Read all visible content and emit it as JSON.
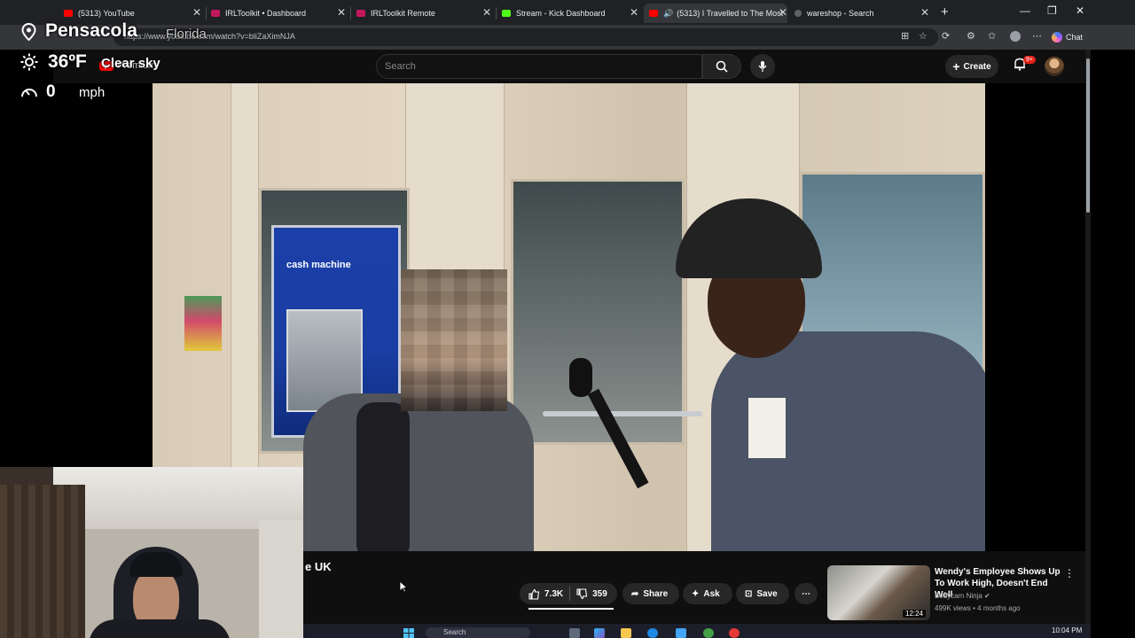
{
  "browser": {
    "tabs": [
      {
        "label": "(5313) YouTube",
        "color": "#ff0000"
      },
      {
        "label": "IRLToolkit • Dashboard",
        "color": "#c2185b"
      },
      {
        "label": "IRLToolkit Remote",
        "color": "#c2185b"
      },
      {
        "label": "Stream - Kick Dashboard",
        "color": "#53fc18"
      },
      {
        "label": "(5313) I Travelled to The Most",
        "color": "#ff0000"
      },
      {
        "label": "wareshop - Search",
        "color": "#5f6368"
      }
    ],
    "url": "https://www.youtube.com/watch?v=bliZaXimNJA",
    "chat_label": "Chat"
  },
  "youtube": {
    "premium_label": "Premium",
    "search_placeholder": "Search",
    "create_label": "Create",
    "notifications_badge": "9+",
    "video_title_fragment": "e UK",
    "actions": {
      "likes": "7.3K",
      "dislikes": "359",
      "share": "Share",
      "ask": "Ask",
      "save": "Save"
    },
    "recommended": {
      "title": "Wendy's Employee Shows Up To Work High, Doesn't End Well",
      "channel": "Bodycam Ninja",
      "meta": "499K views • 4 months ago",
      "duration": "12:24"
    }
  },
  "video_scene": {
    "atm_label": "cash machine"
  },
  "overlay": {
    "city": "Pensacola",
    "state": "Florida",
    "temperature": "36ºF",
    "condition": "Clear sky",
    "speed": "0",
    "speed_unit": "mph"
  },
  "taskbar": {
    "search_label": "Search",
    "clock": "10:04 PM"
  },
  "icons": [
    "location-pin-icon",
    "sun-icon",
    "speedometer-icon",
    "search-icon",
    "mic-icon",
    "bell-icon",
    "like-icon",
    "dislike-icon",
    "share-icon",
    "sparkle-icon",
    "save-icon",
    "more-icon",
    "windows-icon"
  ]
}
